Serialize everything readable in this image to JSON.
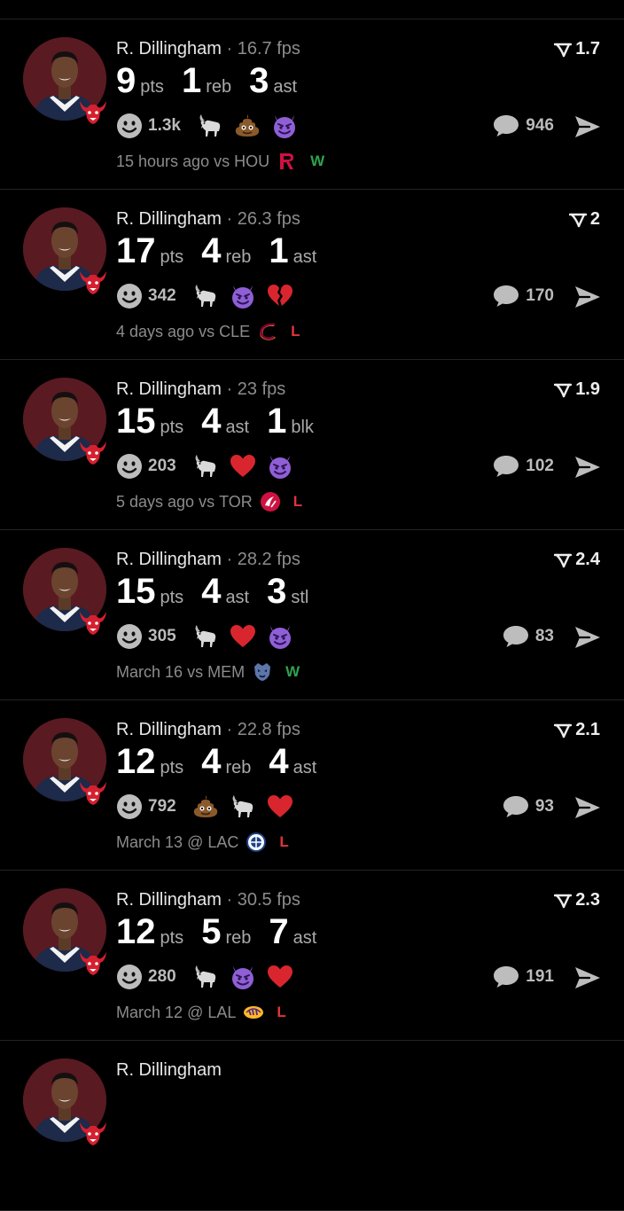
{
  "colors": {
    "background": "#000000",
    "win": "#2fa24d",
    "loss": "#e0343a",
    "avatar_bg": "#5a1a22"
  },
  "posts": [
    {
      "player": "R. Dillingham",
      "fps": "16.7 fps",
      "rating": "1.7",
      "stats": [
        {
          "value": "9",
          "label": "pts"
        },
        {
          "value": "1",
          "label": "reb"
        },
        {
          "value": "3",
          "label": "ast"
        }
      ],
      "reactions_count": "1.3k",
      "reactions": [
        "goat-icon",
        "poop-icon",
        "devil-icon"
      ],
      "comments": "946",
      "time": "15 hours ago",
      "venue": "vs",
      "opponent": "HOU",
      "opponent_logo": "rockets-logo-icon",
      "result": "W"
    },
    {
      "player": "R. Dillingham",
      "fps": "26.3 fps",
      "rating": "2",
      "stats": [
        {
          "value": "17",
          "label": "pts"
        },
        {
          "value": "4",
          "label": "reb"
        },
        {
          "value": "1",
          "label": "ast"
        }
      ],
      "reactions_count": "342",
      "reactions": [
        "goat-icon",
        "devil-icon",
        "broken-heart-icon"
      ],
      "comments": "170",
      "time": "4 days ago",
      "venue": "vs",
      "opponent": "CLE",
      "opponent_logo": "cavaliers-logo-icon",
      "result": "L"
    },
    {
      "player": "R. Dillingham",
      "fps": "23 fps",
      "rating": "1.9",
      "stats": [
        {
          "value": "15",
          "label": "pts"
        },
        {
          "value": "4",
          "label": "ast"
        },
        {
          "value": "1",
          "label": "blk"
        }
      ],
      "reactions_count": "203",
      "reactions": [
        "goat-icon",
        "heart-icon",
        "devil-icon"
      ],
      "comments": "102",
      "time": "5 days ago",
      "venue": "vs",
      "opponent": "TOR",
      "opponent_logo": "raptors-logo-icon",
      "result": "L"
    },
    {
      "player": "R. Dillingham",
      "fps": "28.2 fps",
      "rating": "2.4",
      "stats": [
        {
          "value": "15",
          "label": "pts"
        },
        {
          "value": "4",
          "label": "ast"
        },
        {
          "value": "3",
          "label": "stl"
        }
      ],
      "reactions_count": "305",
      "reactions": [
        "goat-icon",
        "heart-icon",
        "devil-icon"
      ],
      "comments": "83",
      "time": "March 16",
      "venue": "vs",
      "opponent": "MEM",
      "opponent_logo": "grizzlies-logo-icon",
      "result": "W"
    },
    {
      "player": "R. Dillingham",
      "fps": "22.8 fps",
      "rating": "2.1",
      "stats": [
        {
          "value": "12",
          "label": "pts"
        },
        {
          "value": "4",
          "label": "reb"
        },
        {
          "value": "4",
          "label": "ast"
        }
      ],
      "reactions_count": "792",
      "reactions": [
        "poop-icon",
        "goat-icon",
        "heart-icon"
      ],
      "comments": "93",
      "time": "March 13",
      "venue": "@",
      "opponent": "LAC",
      "opponent_logo": "clippers-logo-icon",
      "result": "L"
    },
    {
      "player": "R. Dillingham",
      "fps": "30.5 fps",
      "rating": "2.3",
      "stats": [
        {
          "value": "12",
          "label": "pts"
        },
        {
          "value": "5",
          "label": "reb"
        },
        {
          "value": "7",
          "label": "ast"
        }
      ],
      "reactions_count": "280",
      "reactions": [
        "goat-icon",
        "devil-icon",
        "heart-icon"
      ],
      "comments": "191",
      "time": "March 12",
      "venue": "@",
      "opponent": "LAL",
      "opponent_logo": "lakers-logo-icon",
      "result": "L"
    },
    {
      "player": "R. Dillingham",
      "fps": "",
      "rating": "",
      "stats": [],
      "reactions_count": "",
      "reactions": [],
      "comments": "",
      "time": "",
      "venue": "",
      "opponent": "",
      "opponent_logo": "",
      "result": ""
    }
  ]
}
